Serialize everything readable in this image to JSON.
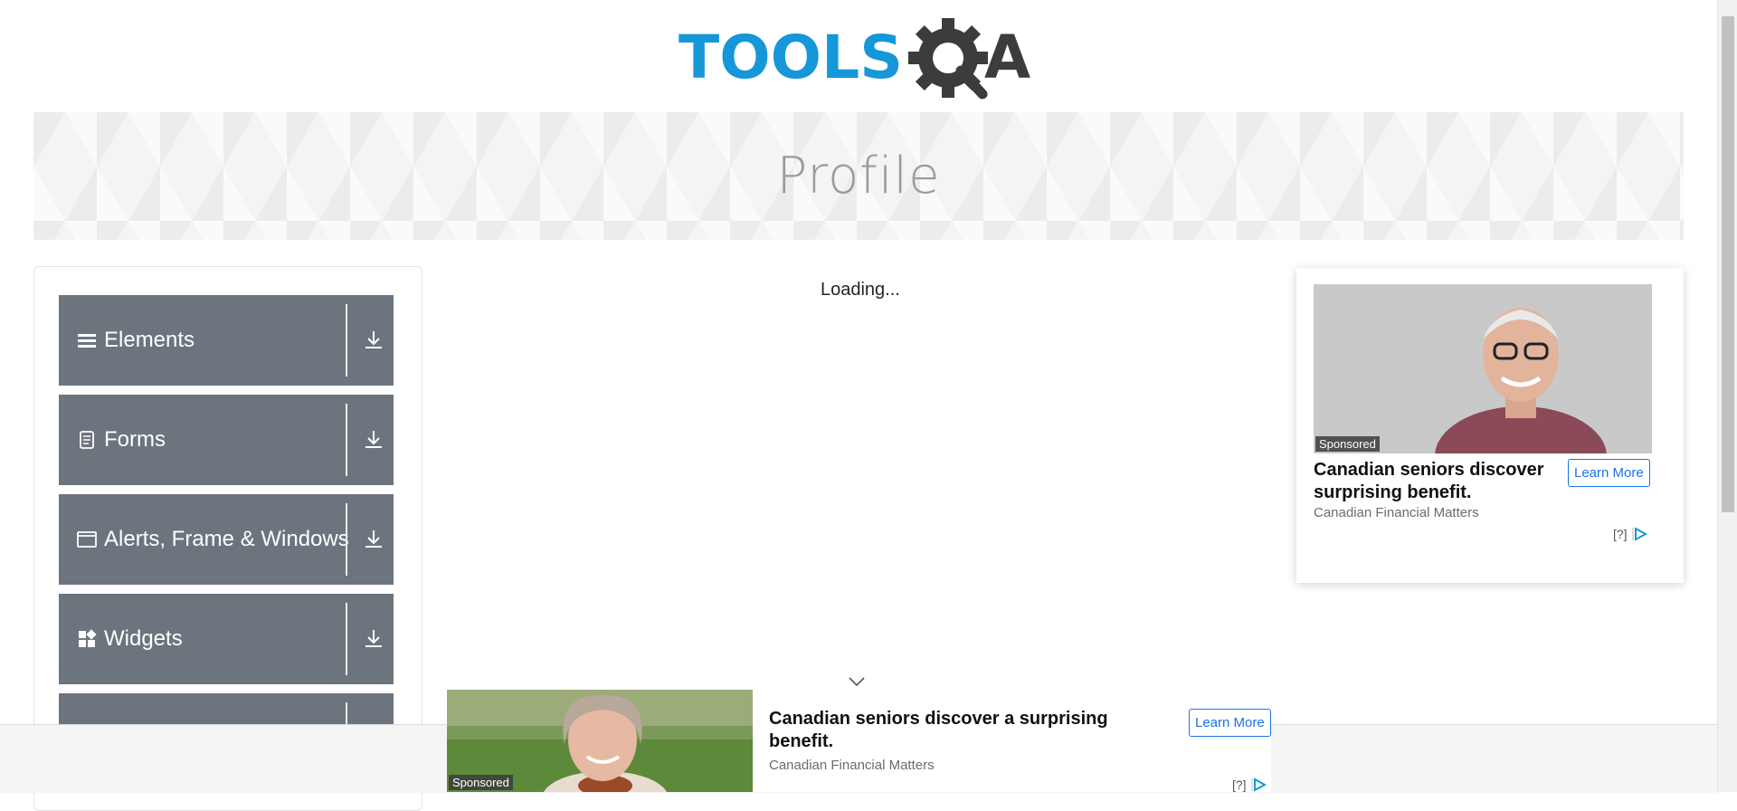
{
  "logo": {
    "text_left": "TOOLS",
    "text_right": "A",
    "colors": {
      "tools": "#1597d8",
      "qa": "#3c3c3c"
    }
  },
  "banner": {
    "title": "Profile"
  },
  "sidebar": {
    "items": [
      {
        "label": "Elements",
        "icon": "hamburger-icon"
      },
      {
        "label": "Forms",
        "icon": "document-icon"
      },
      {
        "label": "Alerts, Frame & Windows",
        "icon": "window-icon"
      },
      {
        "label": "Widgets",
        "icon": "widgets-icon"
      },
      {
        "label": "",
        "icon": ""
      }
    ],
    "toggle_icon": "download-icon"
  },
  "main": {
    "status": "Loading..."
  },
  "right_ad": {
    "sponsored": "Sponsored",
    "title": "Canadian seniors discover surprising benefit.",
    "source": "Canadian Financial Matters",
    "cta": "Learn More",
    "adchoices": "[?]"
  },
  "bottom_ad": {
    "sponsored": "Sponsored",
    "title": "Canadian seniors discover a surprising benefit.",
    "source": "Canadian Financial Matters",
    "cta": "Learn More",
    "adchoices": "[?]"
  },
  "colors": {
    "menu_bg": "#6c757d",
    "link": "#1a73e8"
  }
}
